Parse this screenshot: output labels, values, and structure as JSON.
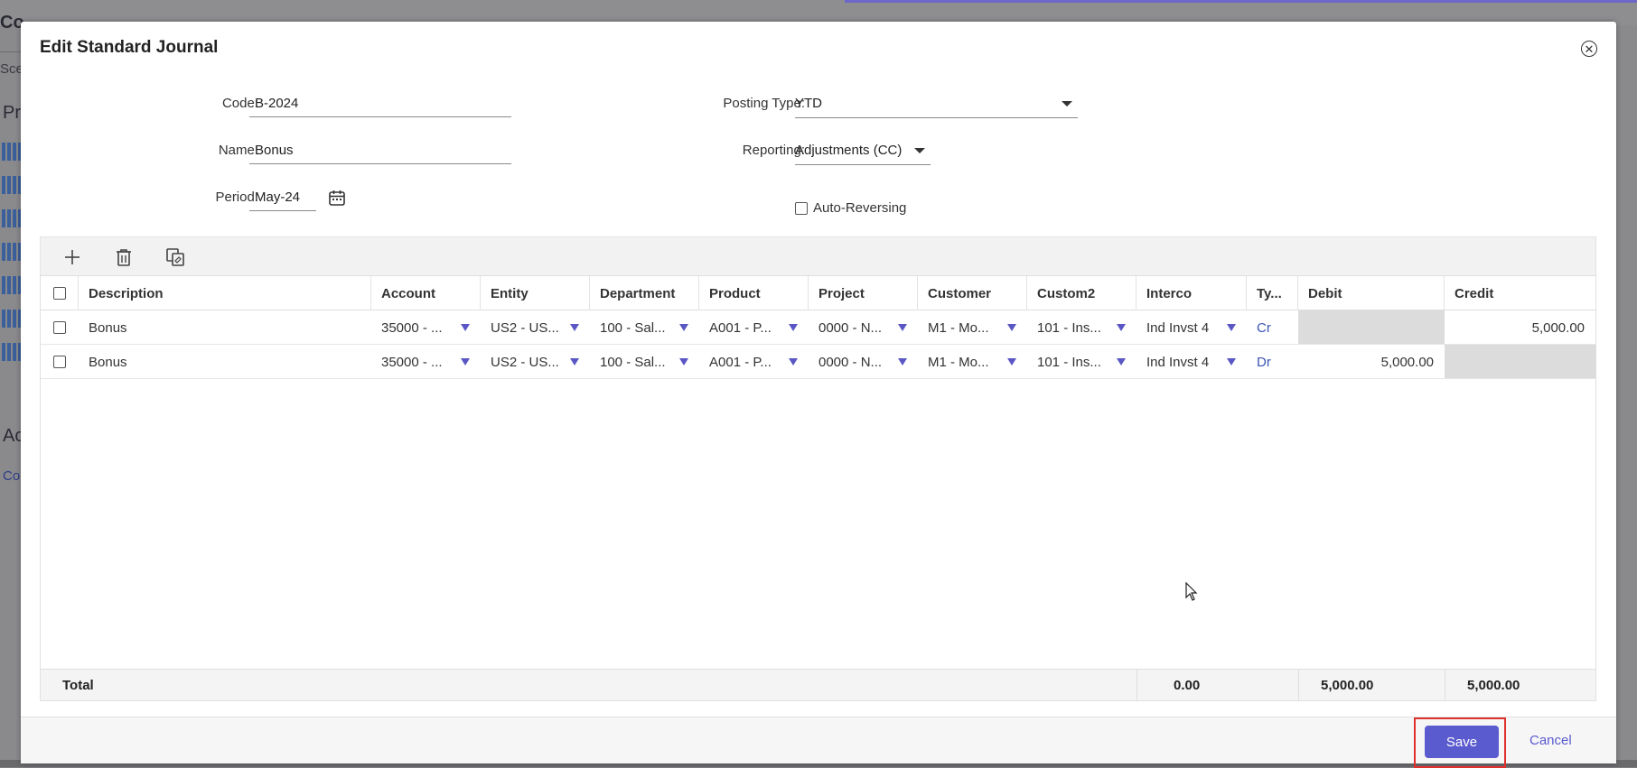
{
  "background": {
    "title": "Consolidation Control Panel",
    "title_fragment": "Co",
    "scenario_fragment": "Sce",
    "section1_fragment": "Pr",
    "section2_fragment": "Ac",
    "link_fragment": "Co"
  },
  "modal": {
    "title": "Edit Standard Journal",
    "close_icon": "close-circle-icon"
  },
  "form": {
    "code_label": "Code:",
    "code_value": "B-2024",
    "name_label": "Name:",
    "name_value": "Bonus",
    "period_label": "Period:",
    "period_value": "May-24",
    "posting_type_label": "Posting Type:",
    "posting_type_value": "YTD",
    "reporting_label": "Reporting:",
    "reporting_value": "Adjustments (CC)",
    "auto_reversing_label": "Auto-Reversing",
    "auto_reversing_checked": false
  },
  "toolbar": {
    "add_icon": "plus-icon",
    "delete_icon": "trash-icon",
    "copy_icon": "copy-icon"
  },
  "grid": {
    "columns": [
      "Description",
      "Account",
      "Entity",
      "Department",
      "Product",
      "Project",
      "Customer",
      "Custom2",
      "Interco",
      "Ty...",
      "Debit",
      "Credit"
    ],
    "rows": [
      {
        "description": "Bonus",
        "account": "35000 - ...",
        "entity": "US2 - US...",
        "department": "100 - Sal...",
        "product": "A001 - P...",
        "project": "0000 - N...",
        "customer": "M1 - Mo...",
        "custom2": "101 - Ins...",
        "interco": "Ind Invst 4",
        "type": "Cr",
        "debit": "",
        "credit": "5,000.00"
      },
      {
        "description": "Bonus",
        "account": "35000 - ...",
        "entity": "US2 - US...",
        "department": "100 - Sal...",
        "product": "A001 - P...",
        "project": "0000 - N...",
        "customer": "M1 - Mo...",
        "custom2": "101 - Ins...",
        "interco": "Ind Invst 4",
        "type": "Dr",
        "debit": "5,000.00",
        "credit": ""
      }
    ],
    "total": {
      "label": "Total",
      "difference": "0.00",
      "debit": "5,000.00",
      "credit": "5,000.00"
    }
  },
  "footer": {
    "save_label": "Save",
    "cancel_label": "Cancel"
  },
  "colors": {
    "accent": "#5b5bd0",
    "highlight": "#e0302e",
    "dropdown_caret": "#5a56c4"
  }
}
